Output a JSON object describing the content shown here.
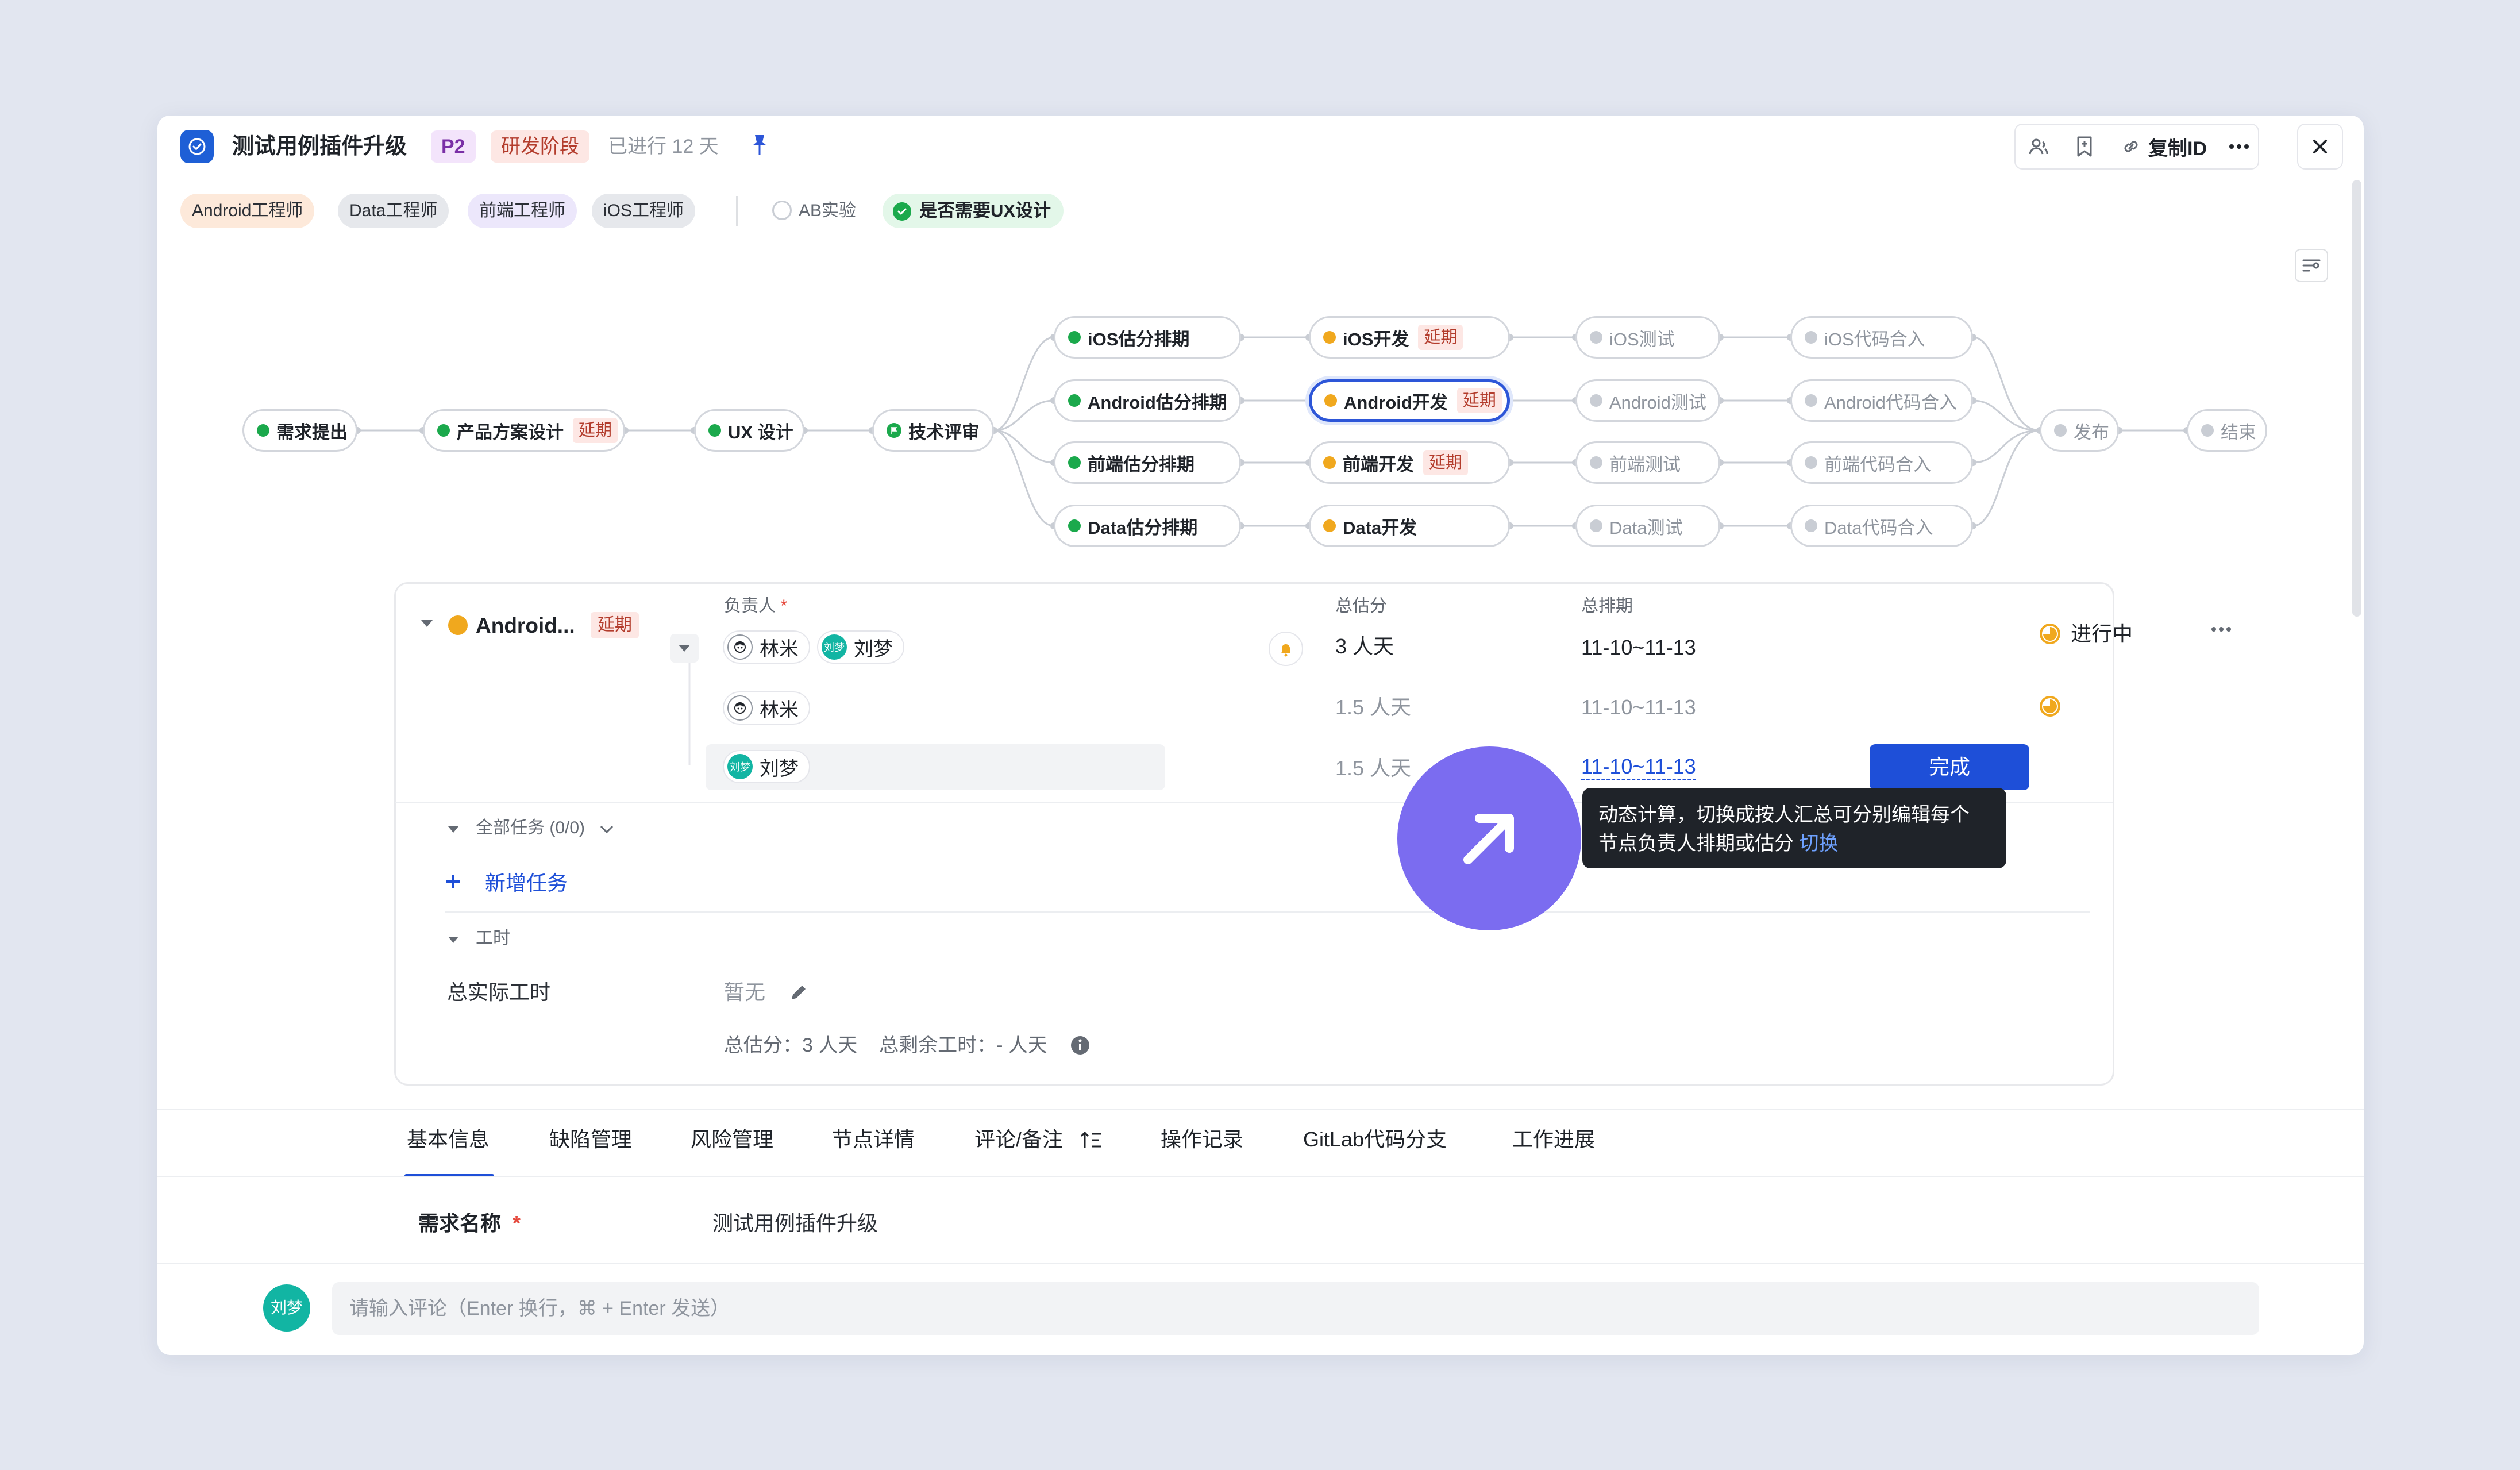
{
  "header": {
    "title": "测试用例插件升级",
    "priority": "P2",
    "stage": "研发阶段",
    "elapsed": "已进行 12 天",
    "copy_id_label": "复制ID"
  },
  "roles": [
    "Android工程师",
    "Data工程师",
    "前端工程师",
    "iOS工程师"
  ],
  "role_colors": [
    "#fde9da",
    "#e6e8ec",
    "#ece7fb",
    "#e6e8ec"
  ],
  "ab_label": "AB实验",
  "ux_label": "是否需要UX设计",
  "flow": {
    "main": [
      {
        "label": "需求提出",
        "status": "green"
      },
      {
        "label": "产品方案设计",
        "status": "green",
        "delay": "延期"
      },
      {
        "label": "UX 设计",
        "status": "green"
      },
      {
        "label": "技术评审",
        "status": "flag"
      }
    ],
    "estimate": [
      {
        "label": "iOS估分排期",
        "status": "green"
      },
      {
        "label": "Android估分排期",
        "status": "green"
      },
      {
        "label": "前端估分排期",
        "status": "green"
      },
      {
        "label": "Data估分排期",
        "status": "green"
      }
    ],
    "develop": [
      {
        "label": "iOS开发",
        "status": "yellow",
        "delay": "延期"
      },
      {
        "label": "Android开发",
        "status": "yellow",
        "delay": "延期",
        "selected": true
      },
      {
        "label": "前端开发",
        "status": "yellow",
        "delay": "延期"
      },
      {
        "label": "Data开发",
        "status": "yellow"
      }
    ],
    "test": [
      {
        "label": "iOS测试",
        "status": "grey"
      },
      {
        "label": "Android测试",
        "status": "grey"
      },
      {
        "label": "前端测试",
        "status": "grey"
      },
      {
        "label": "Data测试",
        "status": "grey"
      }
    ],
    "merge": [
      {
        "label": "iOS代码合入",
        "status": "grey"
      },
      {
        "label": "Android代码合入",
        "status": "grey"
      },
      {
        "label": "前端代码合入",
        "status": "grey"
      },
      {
        "label": "Data代码合入",
        "status": "grey"
      }
    ],
    "release": {
      "label": "发布",
      "status": "grey"
    },
    "end": {
      "label": "结束",
      "status": "grey"
    }
  },
  "detail": {
    "node_name": "Android...",
    "delay": "延期",
    "col_owner": "负责人",
    "col_owner_req": "*",
    "col_estimate": "总估分",
    "col_schedule": "总排期",
    "rows": [
      {
        "people": [
          "林米",
          "刘梦"
        ],
        "estimate": "3 人天",
        "schedule": "11-10~11-13",
        "status": "进行中"
      },
      {
        "people": [
          "林米"
        ],
        "estimate": "1.5 人天",
        "schedule": "11-10~11-13"
      },
      {
        "people": [
          "刘梦"
        ],
        "estimate": "1.5 人天",
        "schedule": "11-10~11-13",
        "action": "完成"
      }
    ],
    "avatar_text": "刘梦",
    "all_tasks": "全部任务 (0/0)",
    "add_task": "新增任务",
    "worktime": "工时",
    "actual_label": "总实际工时",
    "actual_value": "暂无",
    "summary": "总估分：3 人天    总剩余工时：- 人天"
  },
  "tooltip": {
    "line1": "动态计算，切换成按人汇总可分别编辑每个",
    "line2": "节点负责人排期或估分",
    "link": "切换"
  },
  "tabs": [
    "基本信息",
    "缺陷管理",
    "风险管理",
    "节点详情",
    "评论/备注",
    "操作记录",
    "GitLab代码分支",
    "工作进展"
  ],
  "active_tab": "基本信息",
  "basic": {
    "name_label": "需求名称",
    "name_req": "*",
    "name_value": "测试用例插件升级"
  },
  "comment": {
    "avatar": "刘梦",
    "placeholder": "请输入评论（Enter 换行，⌘ + Enter 发送）"
  },
  "colors": {
    "accent": "#1e4fd8",
    "done": "#1ba94c",
    "progress": "#f0a81e",
    "delay_bg": "#fde7e4",
    "fab": "#7b6cf0"
  }
}
